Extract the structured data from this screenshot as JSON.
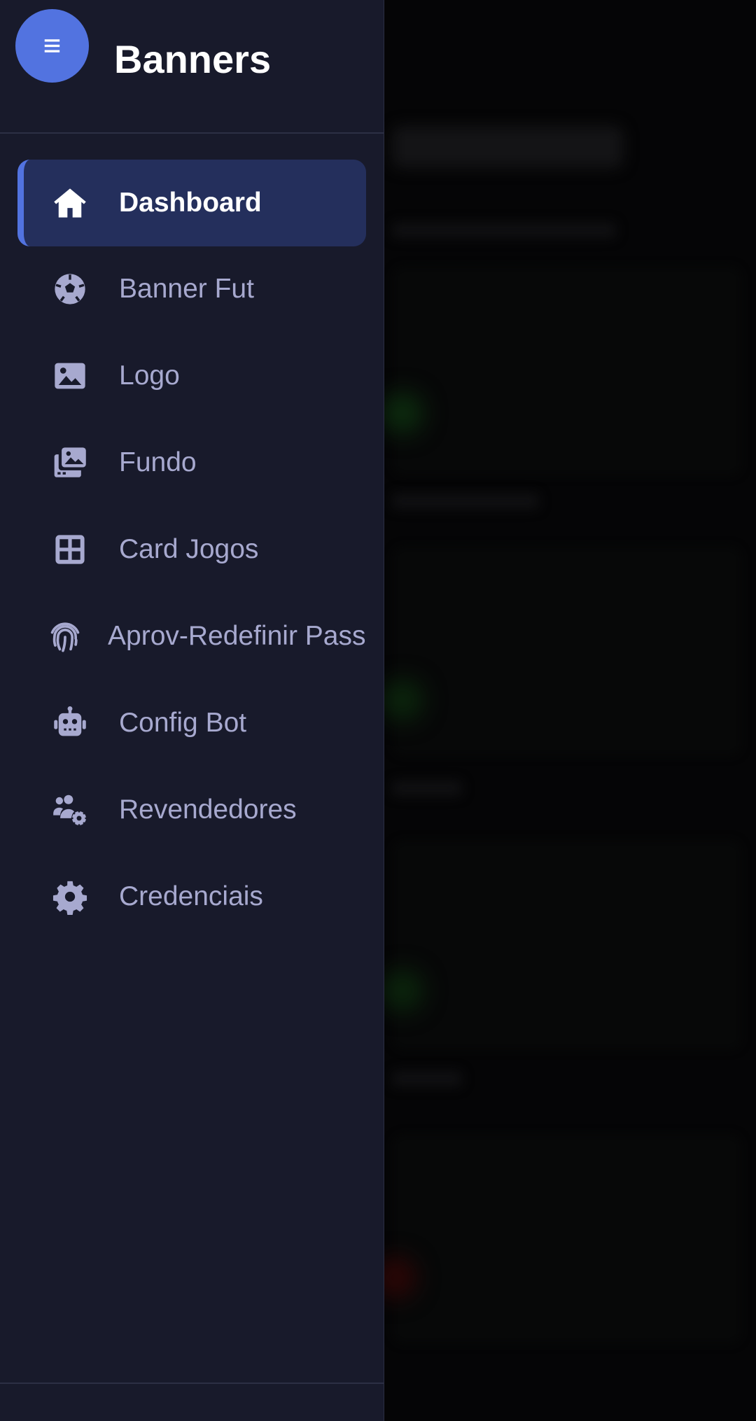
{
  "app": {
    "title": "Banners",
    "menu_icon": "hamburger-icon"
  },
  "sidebar": {
    "items": [
      {
        "label": "Dashboard",
        "icon": "home-icon",
        "active": true
      },
      {
        "label": "Banner Fut",
        "icon": "soccer-ball-icon",
        "active": false
      },
      {
        "label": "Logo",
        "icon": "image-icon",
        "active": false
      },
      {
        "label": "Fundo",
        "icon": "photo-gallery-icon",
        "active": false
      },
      {
        "label": "Card Jogos",
        "icon": "grid-table-icon",
        "active": false
      },
      {
        "label": "Aprov-Redefinir Pass",
        "icon": "fingerprint-icon",
        "active": false
      },
      {
        "label": "Config Bot",
        "icon": "robot-icon",
        "active": false
      },
      {
        "label": "Revendedores",
        "icon": "users-gear-icon",
        "active": false
      },
      {
        "label": "Credenciais",
        "icon": "gear-icon",
        "active": false
      }
    ]
  },
  "colors": {
    "drawer_bg": "#181a2b",
    "accent": "#5273e0",
    "active_bg": "#242f5c",
    "label": "#a7a9cf"
  }
}
